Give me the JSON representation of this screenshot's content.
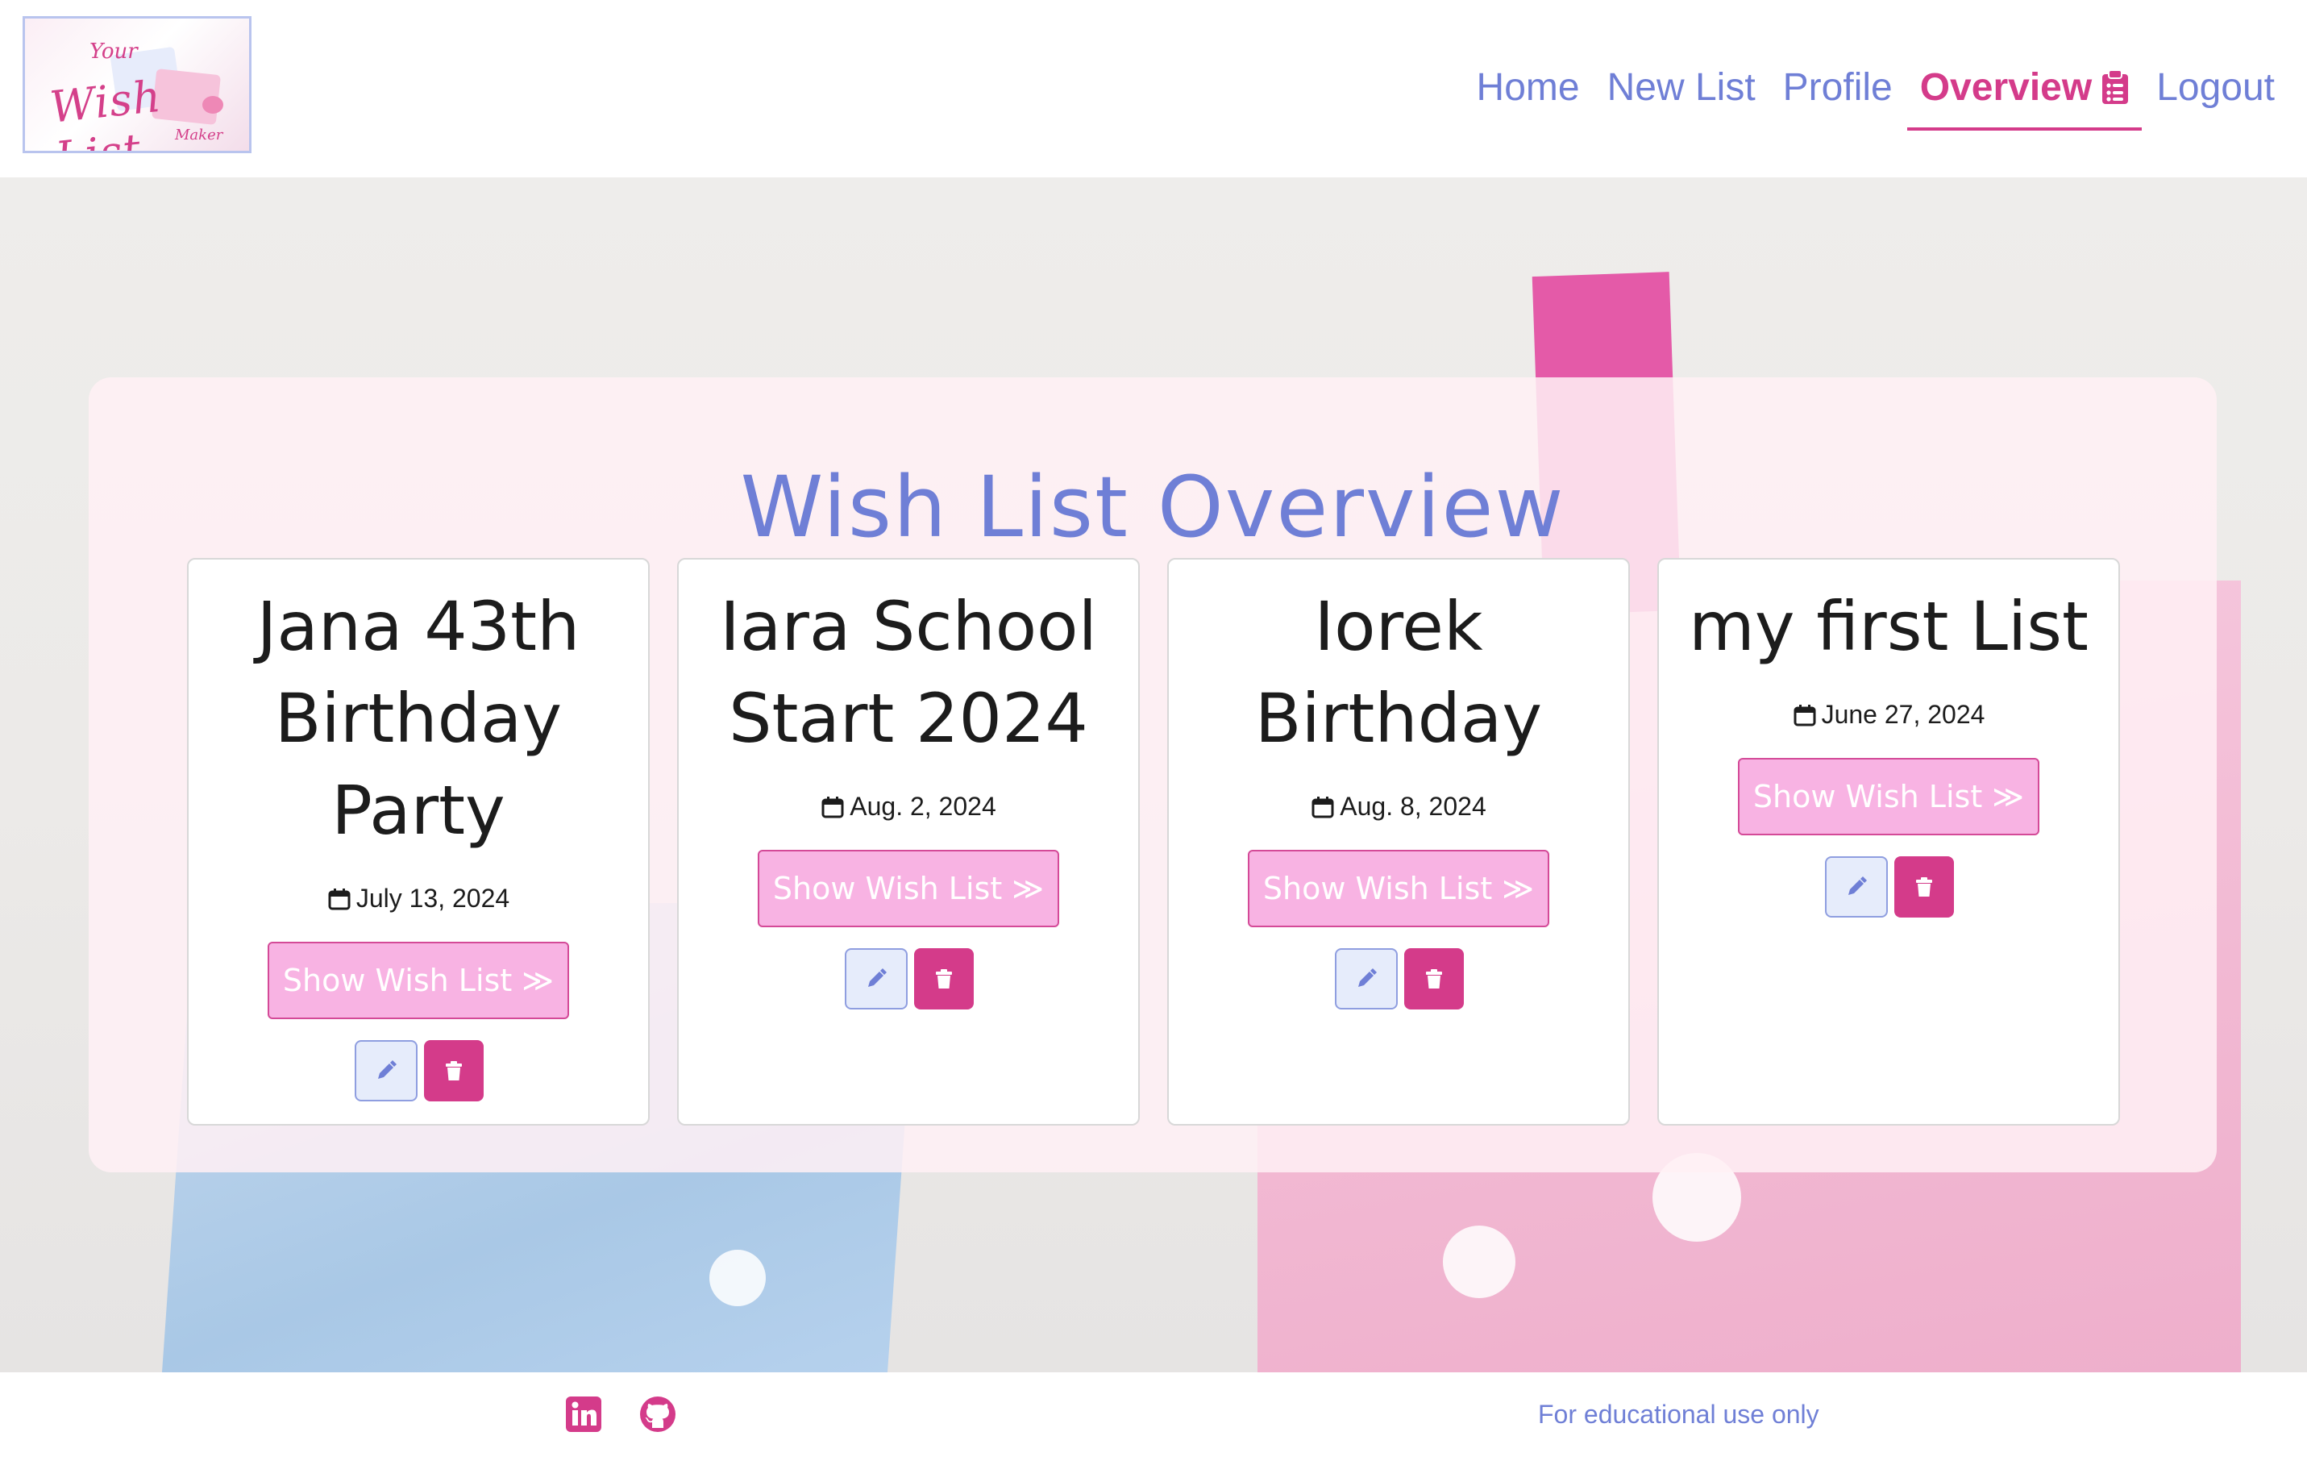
{
  "brand": {
    "logo_top": "Your",
    "logo_main": "Wish List",
    "logo_bottom": "Maker"
  },
  "nav": {
    "home": "Home",
    "new_list": "New List",
    "profile": "Profile",
    "overview": "Overview",
    "logout": "Logout",
    "active": "Overview",
    "active_icon": "clipboard-list-icon"
  },
  "colors": {
    "accent_blue": "#6f7fd6",
    "accent_pink": "#d43b8a",
    "button_pink": "#f8b3e3"
  },
  "overview": {
    "title": "Wish List Overview",
    "show_label": "Show Wish List ≫",
    "cards": [
      {
        "title": "Jana 43th Birthday Party",
        "date": "July 13, 2024"
      },
      {
        "title": "Iara School Start 2024",
        "date": "Aug. 2, 2024"
      },
      {
        "title": "Iorek Birthday",
        "date": "Aug. 8, 2024"
      },
      {
        "title": "my first List",
        "date": "June 27, 2024"
      }
    ]
  },
  "footer": {
    "icons": [
      "linkedin-icon",
      "github-icon"
    ],
    "note": "For educational use only"
  }
}
